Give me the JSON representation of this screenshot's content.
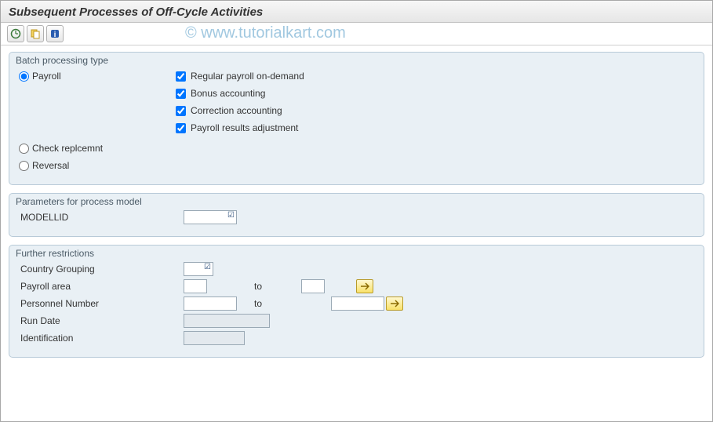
{
  "title": "Subsequent Processes of Off-Cycle Activities",
  "watermark": "© www.tutorialkart.com",
  "groups": {
    "batch": {
      "title": "Batch processing type",
      "radios": {
        "payroll": "Payroll",
        "check_repl": "Check replcemnt",
        "reversal": "Reversal"
      },
      "checks": {
        "regular": "Regular payroll on-demand",
        "bonus": "Bonus accounting",
        "correction": "Correction accounting",
        "adjust": "Payroll results adjustment"
      }
    },
    "params": {
      "title": "Parameters for process model",
      "fields": {
        "modellid": "MODELLID"
      }
    },
    "restrict": {
      "title": "Further restrictions",
      "fields": {
        "country": "Country Grouping",
        "payarea": "Payroll area",
        "pernr": "Personnel Number",
        "rundate": "Run Date",
        "ident": "Identification"
      },
      "to": "to"
    }
  }
}
